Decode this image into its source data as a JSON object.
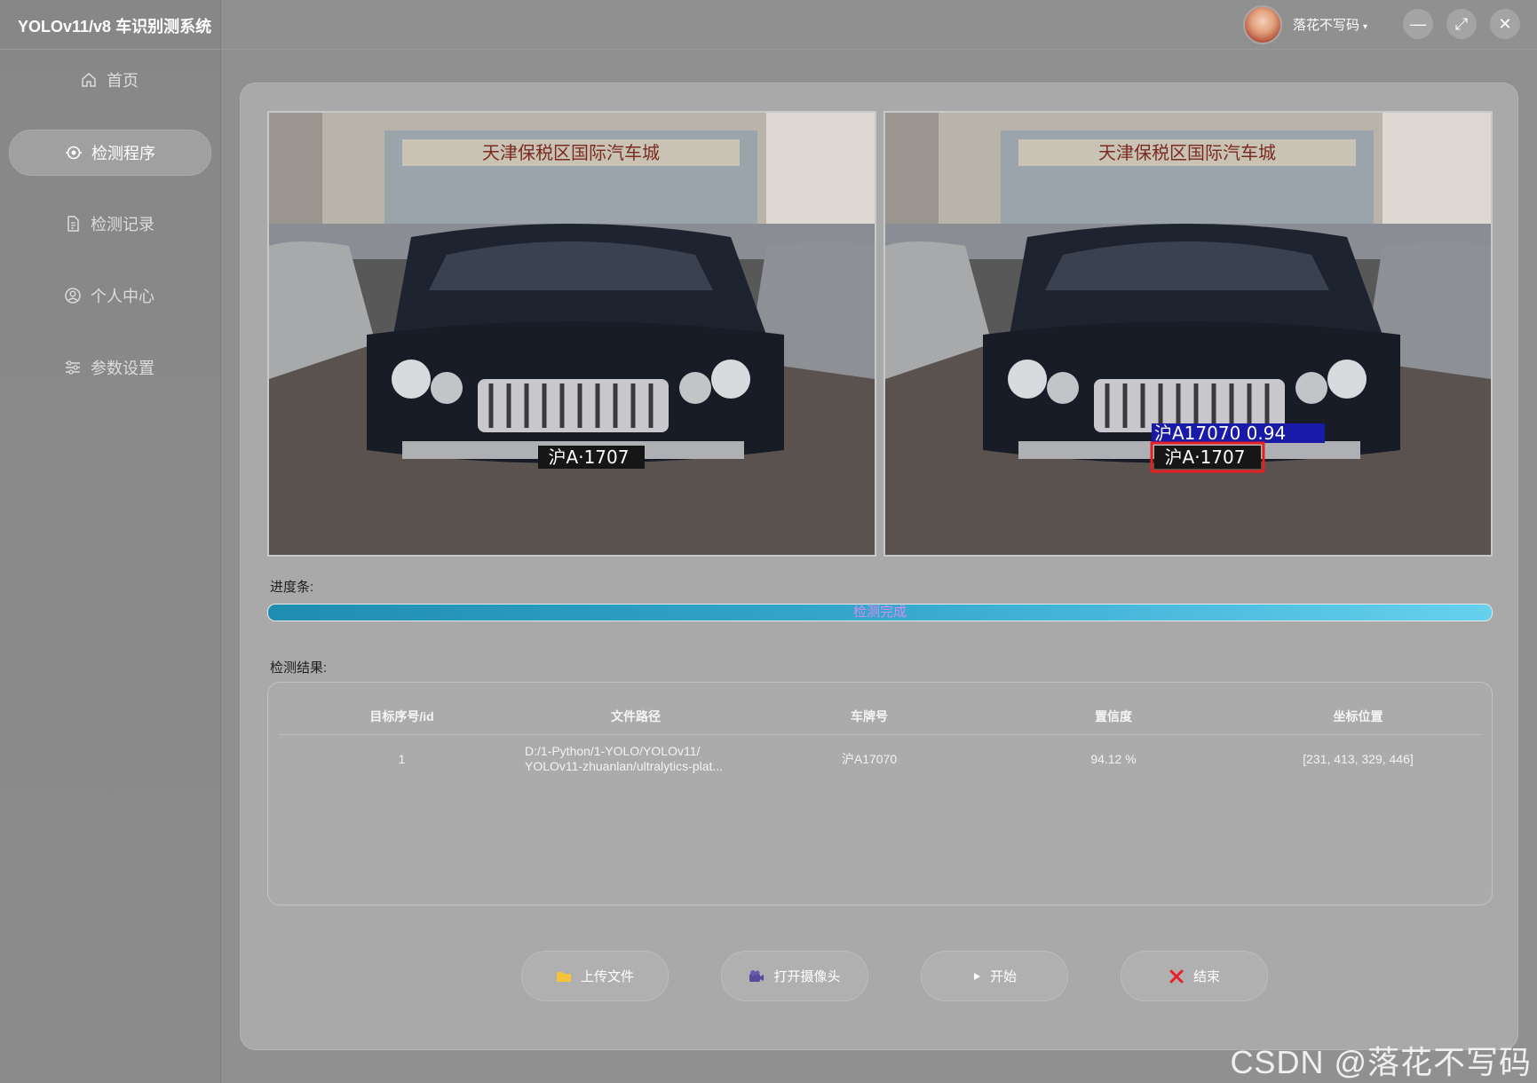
{
  "app": {
    "title": "YOLOv11/v8 车识别测系统"
  },
  "sidebar": {
    "items": [
      {
        "label": "首页",
        "icon": "home-icon",
        "active": false
      },
      {
        "label": "检测程序",
        "icon": "eye-target-icon",
        "active": true
      },
      {
        "label": "检测记录",
        "icon": "document-icon",
        "active": false
      },
      {
        "label": "个人中心",
        "icon": "user-circle-icon",
        "active": false
      },
      {
        "label": "参数设置",
        "icon": "sliders-icon",
        "active": false
      }
    ]
  },
  "topbar": {
    "username": "落花不写码",
    "caret": "▾",
    "minimize": "—",
    "maximize": "⤢",
    "close": "✕"
  },
  "images": {
    "sign_text": "天津保税区国际汽车城",
    "plate_text": "沪A·1707",
    "detection_label": "沪A17070 0.94"
  },
  "progress": {
    "label": "进度条:",
    "text": "检测完成",
    "value_percent": 100
  },
  "results": {
    "label": "检测结果:",
    "columns": [
      "目标序号/id",
      "文件路径",
      "车牌号",
      "置信度",
      "坐标位置"
    ],
    "rows": [
      {
        "id": "1",
        "path_line1": "D:/1-Python/1-YOLO/YOLOv11/",
        "path_line2": "YOLOv11-zhuanlan/ultralytics-plat...",
        "plate": "沪A17070",
        "confidence": "94.12 %",
        "coords": "[231, 413, 329, 446]"
      }
    ]
  },
  "actions": {
    "upload": "上传文件",
    "camera": "打开摄像头",
    "start": "开始",
    "end": "结束"
  },
  "watermark": "CSDN @落花不写码",
  "colors": {
    "progress_start": "#1f8db0",
    "progress_end": "#66d0ef",
    "progress_text": "#d58cf0",
    "detection_box": "#e52020",
    "detection_label_bg": "#1a1aa8"
  }
}
